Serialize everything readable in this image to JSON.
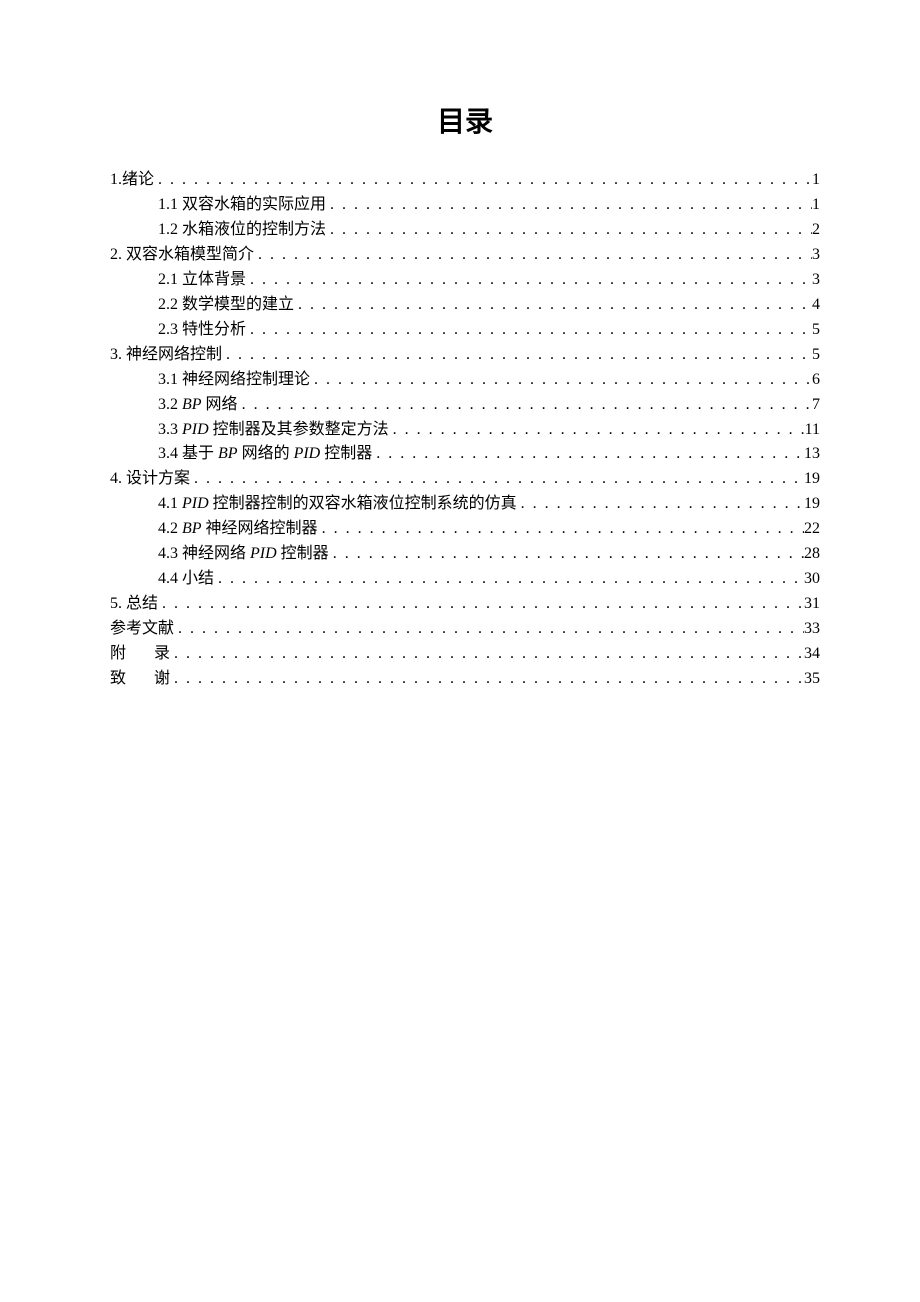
{
  "title": "目录",
  "toc": [
    {
      "level": 1,
      "label_html": "1.绪论",
      "page": "1"
    },
    {
      "level": 2,
      "label_html": "1.1 双容水箱的实际应用",
      "page": "1"
    },
    {
      "level": 2,
      "label_html": "1.2 水箱液位的控制方法",
      "page": "2"
    },
    {
      "level": 1,
      "label_html": "2. 双容水箱模型简介",
      "page": "3"
    },
    {
      "level": 2,
      "label_html": "2.1 立体背景",
      "page": "3"
    },
    {
      "level": 2,
      "label_html": "2.2 数学模型的建立",
      "page": "4"
    },
    {
      "level": 2,
      "label_html": "2.3 特性分析",
      "page": "5"
    },
    {
      "level": 1,
      "label_html": "3. 神经网络控制",
      "page": "5"
    },
    {
      "level": 2,
      "label_html": "3.1 神经网络控制理论",
      "page": "6"
    },
    {
      "level": 2,
      "label_html": "3.2 <span class=\"it\">BP</span> 网络",
      "page": "7"
    },
    {
      "level": 2,
      "label_html": "3.3 <span class=\"it\">PID</span> 控制器及其参数整定方法 ",
      "page": "11"
    },
    {
      "level": 2,
      "label_html": "3.4 基于 <span class=\"it\">BP</span> 网络的 <span class=\"it\">PID</span> 控制器 ",
      "page": "13"
    },
    {
      "level": 1,
      "label_html": "4. 设计方案",
      "page": "19"
    },
    {
      "level": 2,
      "label_html": "4.1 <span class=\"it\">PID</span> 控制器控制的双容水箱液位控制系统的仿真 ",
      "page": "19"
    },
    {
      "level": 2,
      "label_html": "4.2 <span class=\"it\">BP</span> 神经网络控制器 ",
      "page": "22"
    },
    {
      "level": 2,
      "label_html": "4.3 神经网络 <span class=\"it\">PID</span> 控制器 ",
      "page": "28"
    },
    {
      "level": 2,
      "label_html": "4.4 小结 ",
      "page": "30"
    },
    {
      "level": 1,
      "label_html": "5. 总结",
      "page": "31"
    },
    {
      "level": 1,
      "label_html": "参考文献",
      "page": "33"
    },
    {
      "level": 1,
      "label_html": "<span class=\"spaced-2\">附</span>录",
      "page": "34"
    },
    {
      "level": 1,
      "label_html": "<span class=\"spaced-2\">致</span>谢",
      "page": "35"
    }
  ]
}
